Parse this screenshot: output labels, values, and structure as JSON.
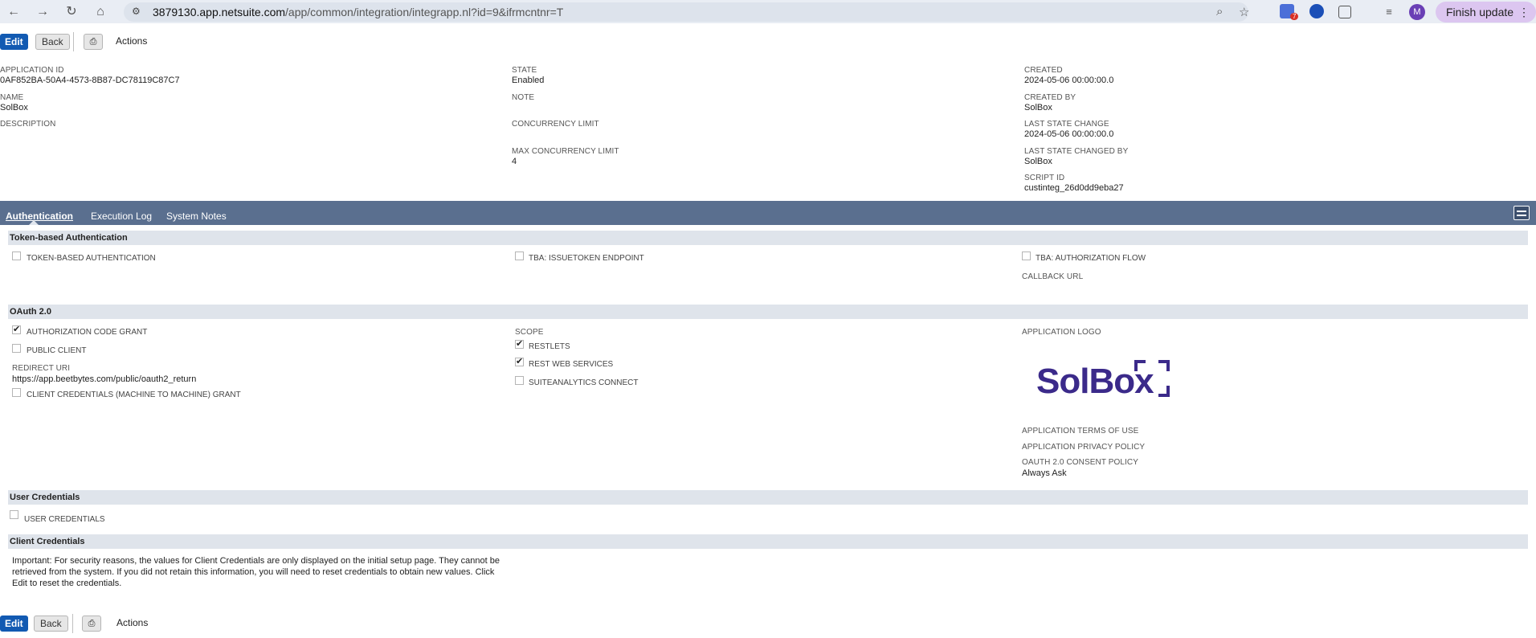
{
  "browser": {
    "url_host": "3879130.app.netsuite.com",
    "url_path": "/app/common/integration/integrapp.nl?id=9&ifrmcntnr=T",
    "extension_badge": "7",
    "profile_initial": "M",
    "finish_update": "Finish update"
  },
  "toolbar": {
    "edit": "Edit",
    "back": "Back",
    "actions": "Actions"
  },
  "fields": {
    "application_id_label": "APPLICATION ID",
    "application_id": "0AF852BA-50A4-4573-8B87-DC78119C87C7",
    "name_label": "NAME",
    "name": "SolBox",
    "description_label": "DESCRIPTION",
    "state_label": "STATE",
    "state": "Enabled",
    "note_label": "NOTE",
    "concurrency_label": "CONCURRENCY LIMIT",
    "max_concurrency_label": "MAX CONCURRENCY LIMIT",
    "max_concurrency": "4",
    "created_label": "CREATED",
    "created": "2024-05-06 00:00:00.0",
    "created_by_label": "CREATED BY",
    "created_by": "SolBox",
    "last_state_change_label": "LAST STATE CHANGE",
    "last_state_change": "2024-05-06 00:00:00.0",
    "last_state_changed_by_label": "LAST STATE CHANGED BY",
    "last_state_changed_by": "SolBox",
    "script_id_label": "SCRIPT ID",
    "script_id": "custinteg_26d0dd9eba27"
  },
  "tabs": [
    {
      "label": "Authentication"
    },
    {
      "label": "Execution Log"
    },
    {
      "label": "System Notes"
    }
  ],
  "tba": {
    "title": "Token-based Authentication",
    "tba_label": "TOKEN-BASED AUTHENTICATION",
    "issuetoken_label": "TBA: ISSUETOKEN ENDPOINT",
    "authflow_label": "TBA: AUTHORIZATION FLOW",
    "callback_label": "CALLBACK URL"
  },
  "oauth": {
    "title": "OAuth 2.0",
    "auth_code_label": "AUTHORIZATION CODE GRANT",
    "public_client_label": "PUBLIC CLIENT",
    "redirect_uri_label": "REDIRECT URI",
    "redirect_uri": "https://app.beetbytes.com/public/oauth2_return",
    "client_credentials_label": "CLIENT CREDENTIALS (MACHINE TO MACHINE) GRANT",
    "scope_label": "SCOPE",
    "restlets_label": "RESTLETS",
    "rest_ws_label": "REST WEB SERVICES",
    "suiteanalytics_label": "SUITEANALYTICS CONNECT",
    "app_logo_label": "APPLICATION LOGO",
    "logo_text": "SolBox",
    "terms_label": "APPLICATION TERMS OF USE",
    "privacy_label": "APPLICATION PRIVACY POLICY",
    "consent_label": "OAUTH 2.0 CONSENT POLICY",
    "consent": "Always Ask"
  },
  "user_credentials": {
    "title": "User Credentials",
    "label": "USER CREDENTIALS"
  },
  "client_credentials": {
    "title": "Client Credentials",
    "notice": "Important: For security reasons, the values for Client Credentials are only displayed on the initial setup page. They cannot be retrieved from the system. If you did not retain this information, you will need to reset credentials to obtain new values. Click Edit to reset the credentials."
  },
  "checks": {
    "tba": false,
    "issuetoken": false,
    "authflow": false,
    "auth_code": true,
    "public_client": false,
    "client_creds": false,
    "restlets": true,
    "rest_ws": true,
    "suiteanalytics": false,
    "user_creds": false
  },
  "colors": {
    "accent": "#125ab2",
    "tabbar": "#5a6f8f",
    "section": "#dfe4eb",
    "logo": "#3b2a8a"
  }
}
